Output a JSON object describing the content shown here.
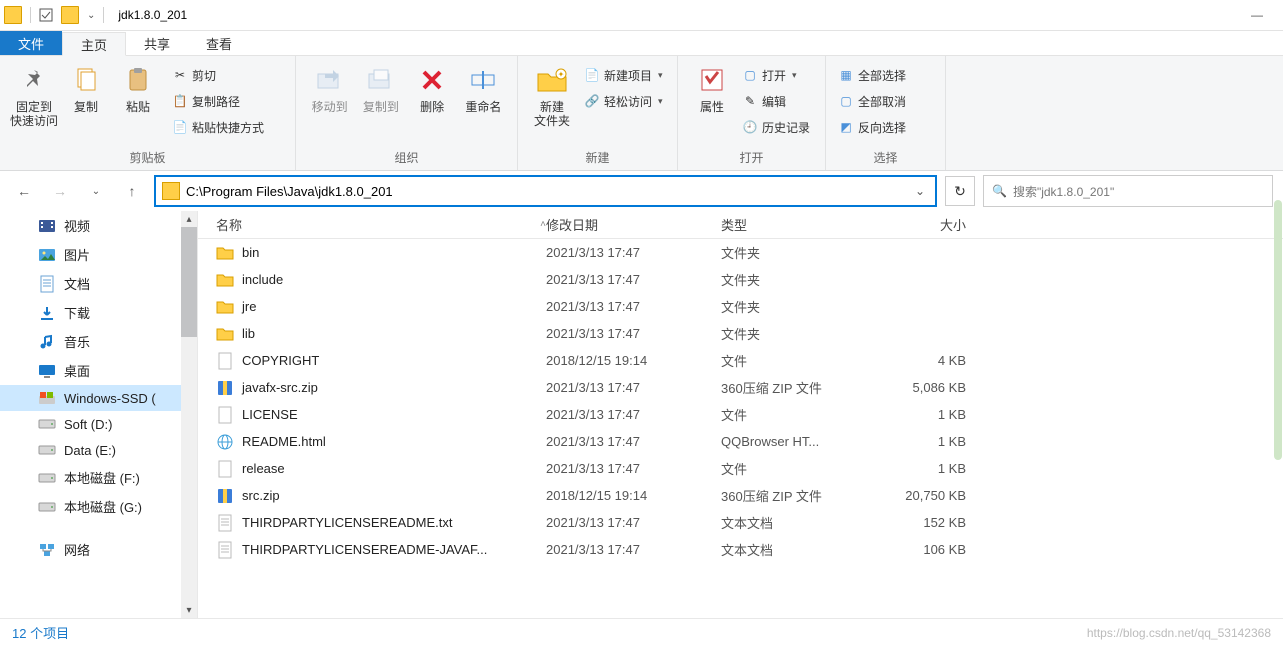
{
  "window": {
    "title": "jdk1.8.0_201"
  },
  "tabs": {
    "file": "文件",
    "home": "主页",
    "share": "共享",
    "view": "查看"
  },
  "ribbon": {
    "clipboard": {
      "label": "剪贴板",
      "pin": "固定到\n快速访问",
      "copy": "复制",
      "paste": "粘贴",
      "cut": "剪切",
      "copypath": "复制路径",
      "pasteshortcut": "粘贴快捷方式"
    },
    "organize": {
      "label": "组织",
      "moveto": "移动到",
      "copyto": "复制到",
      "delete": "删除",
      "rename": "重命名"
    },
    "new": {
      "label": "新建",
      "newfolder": "新建\n文件夹",
      "newitem": "新建项目",
      "easyaccess": "轻松访问"
    },
    "open": {
      "label": "打开",
      "properties": "属性",
      "open": "打开",
      "edit": "编辑",
      "history": "历史记录"
    },
    "select": {
      "label": "选择",
      "all": "全部选择",
      "none": "全部取消",
      "invert": "反向选择"
    }
  },
  "address": "C:\\Program Files\\Java\\jdk1.8.0_201",
  "search": {
    "placeholder": "搜索\"jdk1.8.0_201\""
  },
  "leftnav": {
    "items": [
      {
        "label": "视频",
        "icon": "video"
      },
      {
        "label": "图片",
        "icon": "picture"
      },
      {
        "label": "文档",
        "icon": "document"
      },
      {
        "label": "下载",
        "icon": "download"
      },
      {
        "label": "音乐",
        "icon": "music"
      },
      {
        "label": "桌面",
        "icon": "desktop"
      },
      {
        "label": "Windows-SSD (",
        "icon": "windisk",
        "selected": true
      },
      {
        "label": "Soft (D:)",
        "icon": "disk"
      },
      {
        "label": "Data (E:)",
        "icon": "disk"
      },
      {
        "label": "本地磁盘 (F:)",
        "icon": "disk"
      },
      {
        "label": "本地磁盘 (G:)",
        "icon": "disk"
      },
      {
        "label": "网络",
        "icon": "network",
        "gap": true
      }
    ]
  },
  "columns": {
    "name": "名称",
    "date": "修改日期",
    "type": "类型",
    "size": "大小"
  },
  "files": [
    {
      "name": "bin",
      "date": "2021/3/13 17:47",
      "type": "文件夹",
      "size": "",
      "icon": "folder"
    },
    {
      "name": "include",
      "date": "2021/3/13 17:47",
      "type": "文件夹",
      "size": "",
      "icon": "folder"
    },
    {
      "name": "jre",
      "date": "2021/3/13 17:47",
      "type": "文件夹",
      "size": "",
      "icon": "folder"
    },
    {
      "name": "lib",
      "date": "2021/3/13 17:47",
      "type": "文件夹",
      "size": "",
      "icon": "folder"
    },
    {
      "name": "COPYRIGHT",
      "date": "2018/12/15 19:14",
      "type": "文件",
      "size": "4 KB",
      "icon": "file"
    },
    {
      "name": "javafx-src.zip",
      "date": "2021/3/13 17:47",
      "type": "360压缩 ZIP 文件",
      "size": "5,086 KB",
      "icon": "zip"
    },
    {
      "name": "LICENSE",
      "date": "2021/3/13 17:47",
      "type": "文件",
      "size": "1 KB",
      "icon": "file"
    },
    {
      "name": "README.html",
      "date": "2021/3/13 17:47",
      "type": "QQBrowser HT...",
      "size": "1 KB",
      "icon": "html"
    },
    {
      "name": "release",
      "date": "2021/3/13 17:47",
      "type": "文件",
      "size": "1 KB",
      "icon": "file"
    },
    {
      "name": "src.zip",
      "date": "2018/12/15 19:14",
      "type": "360压缩 ZIP 文件",
      "size": "20,750 KB",
      "icon": "zip"
    },
    {
      "name": "THIRDPARTYLICENSEREADME.txt",
      "date": "2021/3/13 17:47",
      "type": "文本文档",
      "size": "152 KB",
      "icon": "txt"
    },
    {
      "name": "THIRDPARTYLICENSEREADME-JAVAF...",
      "date": "2021/3/13 17:47",
      "type": "文本文档",
      "size": "106 KB",
      "icon": "txt"
    }
  ],
  "status": {
    "count": "12 个项目",
    "watermark": "https://blog.csdn.net/qq_53142368"
  }
}
